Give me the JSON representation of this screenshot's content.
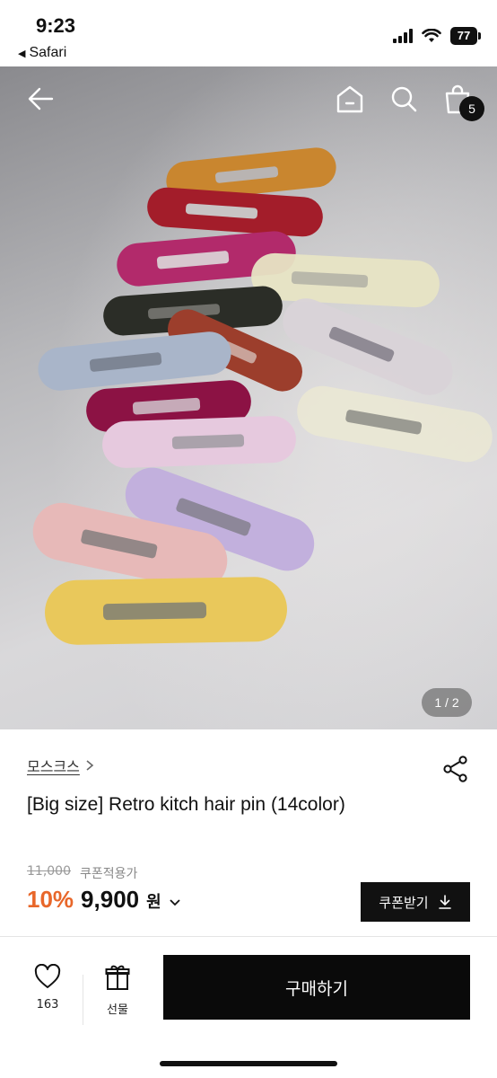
{
  "status_bar": {
    "time": "9:23",
    "back_app": "Safari",
    "battery": "77"
  },
  "header": {
    "cart_count": "5"
  },
  "gallery": {
    "pager": "1 / 2"
  },
  "product": {
    "brand": "모스크스",
    "title": "[Big size] Retro kitch hair pin (14color)",
    "original_price": "11,000",
    "coupon_note": "쿠폰적용가",
    "discount": "10%",
    "price": "9,900",
    "currency": "원",
    "coupon_button": "쿠폰받기"
  },
  "bottom_bar": {
    "like_count": "163",
    "gift_label": "선물",
    "buy_label": "구매하기"
  },
  "colors": {
    "discount": "#e8672a",
    "button": "#111111"
  }
}
